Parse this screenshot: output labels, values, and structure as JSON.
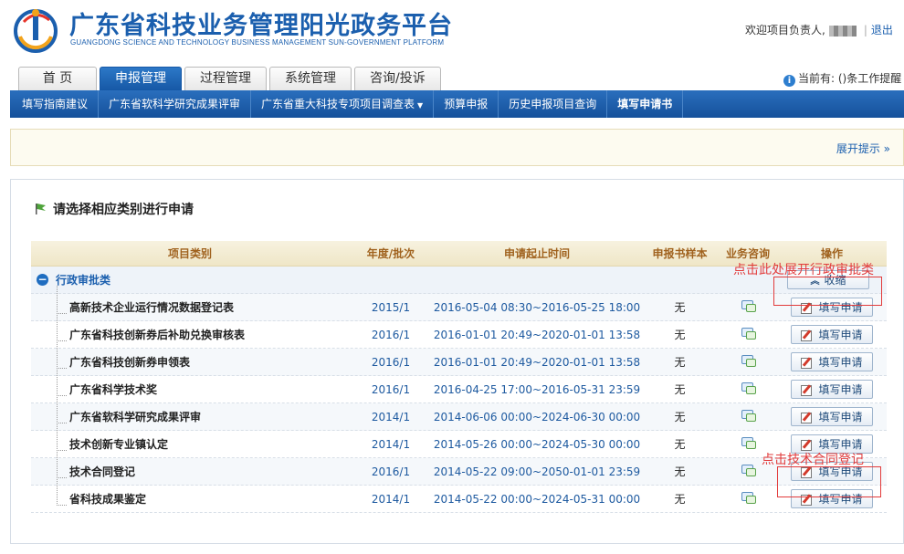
{
  "header": {
    "title_cn": "广东省科技业务管理阳光政务平台",
    "title_en": "GUANGDONG SCIENCE AND TECHNOLOGY BUSINESS MANAGEMENT SUN-GOVERNMENT PLATFORM",
    "welcome": "欢迎项目负责人,",
    "separator": "|",
    "logout": "退出"
  },
  "tabs": [
    {
      "label": "首 页",
      "active": false
    },
    {
      "label": "申报管理",
      "active": true
    },
    {
      "label": "过程管理",
      "active": false
    },
    {
      "label": "系统管理",
      "active": false
    },
    {
      "label": "咨询/投诉",
      "active": false
    }
  ],
  "notice": {
    "icon": "info-icon",
    "text": "当前有: ()条工作提醒"
  },
  "subnav": [
    {
      "label": "填写指南建议",
      "active": false
    },
    {
      "label": "广东省软科学研究成果评审",
      "active": false
    },
    {
      "label": "广东省重大科技专项项目调查表",
      "active": false,
      "has_caret": true
    },
    {
      "label": "预算申报",
      "active": false
    },
    {
      "label": "历史申报项目查询",
      "active": false
    },
    {
      "label": "填写申请书",
      "active": true
    }
  ],
  "hint": {
    "expand_label": "展开提示",
    "icon": "double-chevron-down-icon"
  },
  "panel": {
    "title": "请选择相应类别进行申请",
    "columns": [
      "项目类别",
      "年度/批次",
      "申请起止时间",
      "申报书样本",
      "业务咨询",
      "操作"
    ],
    "group": {
      "label": "行政审批类",
      "collapse_label": "收缩"
    },
    "rows": [
      {
        "name": "高新技术企业运行情况数据登记表",
        "batch": "2015/1",
        "period": "2016-05-04 08:30~2016-05-25 18:00",
        "sample": "无",
        "action": "填写申请"
      },
      {
        "name": "广东省科技创新券后补助兑换审核表",
        "batch": "2016/1",
        "period": "2016-01-01 20:49~2020-01-01 13:58",
        "sample": "无",
        "action": "填写申请"
      },
      {
        "name": "广东省科技创新券申领表",
        "batch": "2016/1",
        "period": "2016-01-01 20:49~2020-01-01 13:58",
        "sample": "无",
        "action": "填写申请"
      },
      {
        "name": "广东省科学技术奖",
        "batch": "2016/1",
        "period": "2016-04-25 17:00~2016-05-31 23:59",
        "sample": "无",
        "action": "填写申请"
      },
      {
        "name": "广东省软科学研究成果评审",
        "batch": "2014/1",
        "period": "2014-06-06 00:00~2024-06-30 00:00",
        "sample": "无",
        "action": "填写申请"
      },
      {
        "name": "技术创新专业镇认定",
        "batch": "2014/1",
        "period": "2014-05-26 00:00~2024-05-30 00:00",
        "sample": "无",
        "action": "填写申请"
      },
      {
        "name": "技术合同登记",
        "batch": "2016/1",
        "period": "2014-05-22 09:00~2050-01-01 23:59",
        "sample": "无",
        "action": "填写申请"
      },
      {
        "name": "省科技成果鉴定",
        "batch": "2014/1",
        "period": "2014-05-22 00:00~2024-05-31 00:00",
        "sample": "无",
        "action": "填写申请"
      }
    ]
  },
  "annotations": [
    {
      "text": "点击此处展开行政审批类"
    },
    {
      "text": "点击技术合同登记"
    }
  ],
  "colors": {
    "brand": "#1b5fae",
    "annotation": "#e23b3b",
    "header_text": "#a0621e"
  }
}
